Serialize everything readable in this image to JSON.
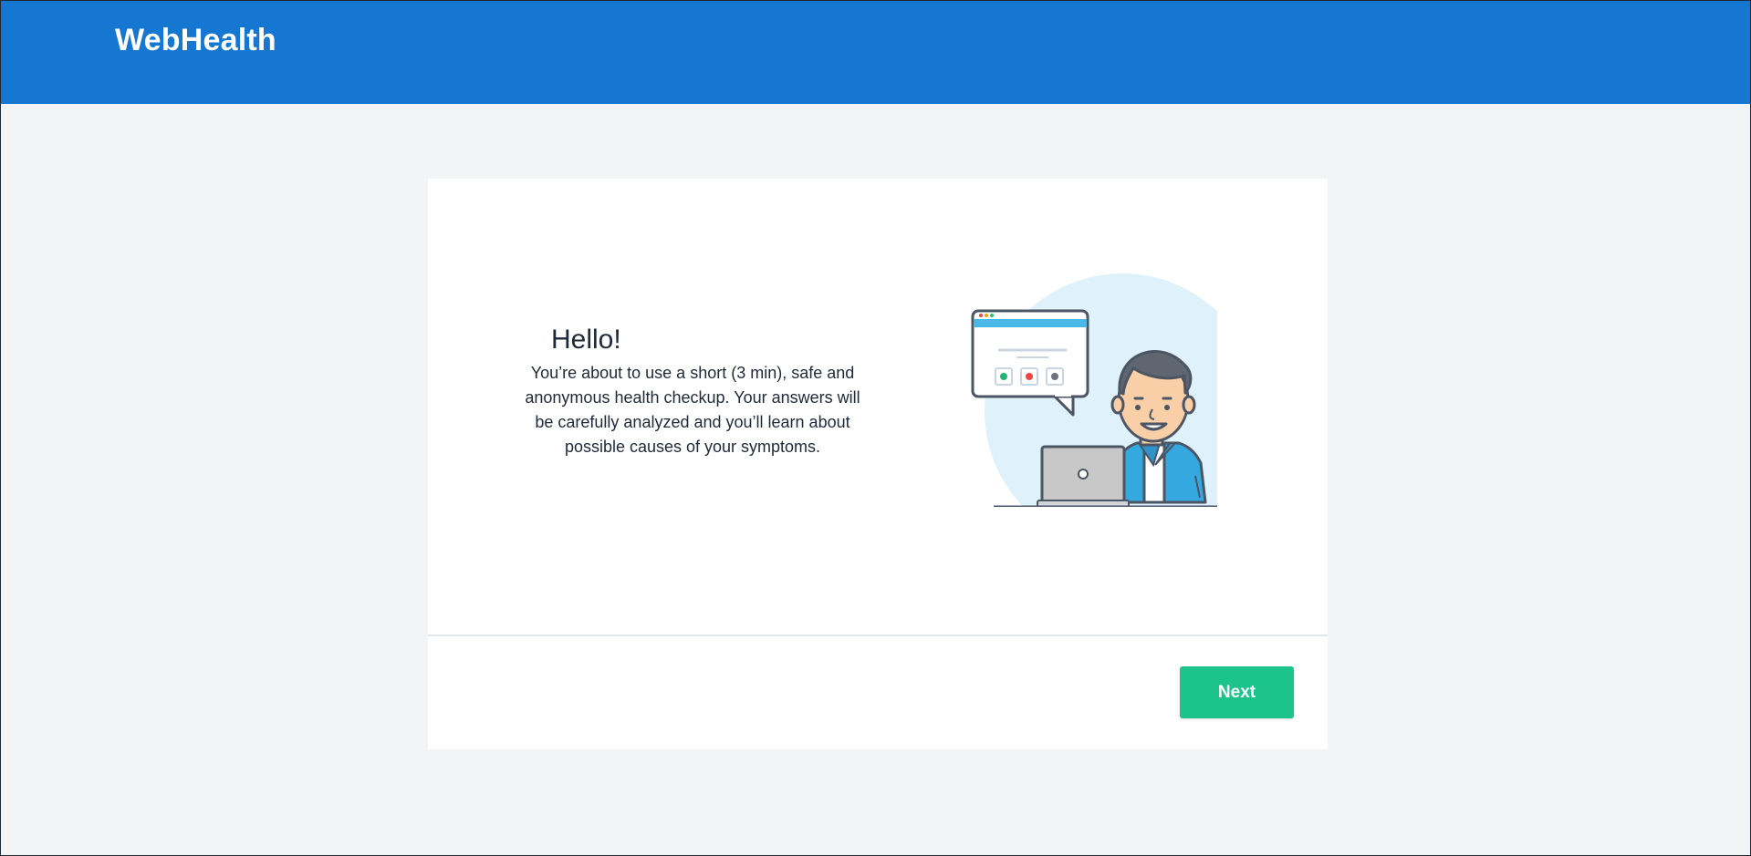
{
  "header": {
    "brand": "WebHealth"
  },
  "welcome": {
    "greeting": "Hello!",
    "description": "You’re about to use a short (3 min), safe and anonymous health checkup. Your answers will be carefully analyzed and you’ll learn about possible causes of your symptoms."
  },
  "actions": {
    "next_label": "Next"
  },
  "colors": {
    "header_bg": "#1677d2",
    "page_bg": "#f3f4f6",
    "card_bg": "#ffffff",
    "primary_button": "#1cc48b",
    "illustration_circle": "#dff1fb",
    "shirt": "#35a8e0"
  },
  "illustration": {
    "icon": "person-at-laptop-illustration",
    "bubble_dots": [
      "green",
      "red",
      "gray"
    ]
  }
}
